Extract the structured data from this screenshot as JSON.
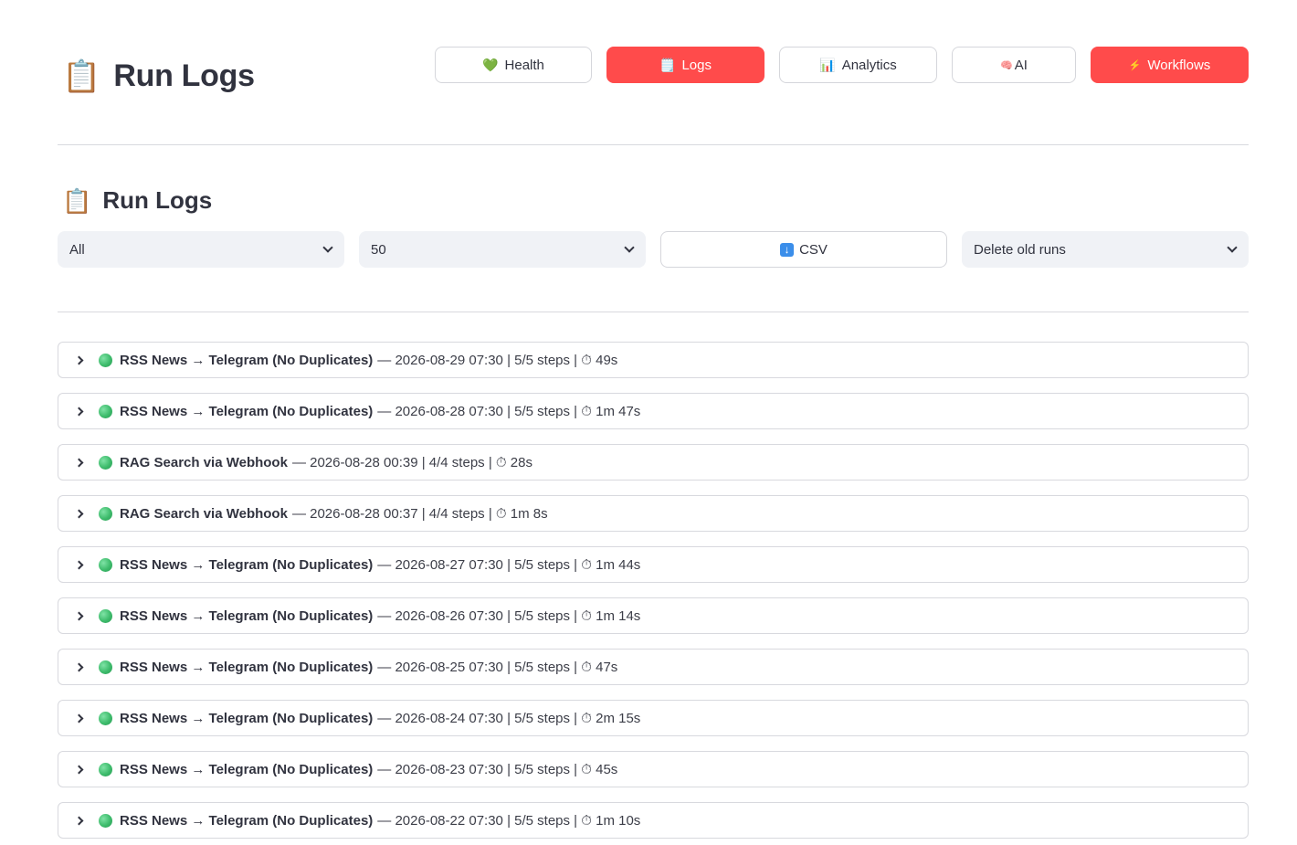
{
  "header": {
    "icon": "clipboard-icon",
    "title": "Run Logs"
  },
  "nav": [
    {
      "label": "Health",
      "icon": "💚",
      "icon_name": "green-heart-icon",
      "active": false
    },
    {
      "label": "Logs",
      "icon": "🗒️",
      "icon_name": "notepad-icon",
      "active": true
    },
    {
      "label": "Analytics",
      "icon": "📊",
      "icon_name": "bar-chart-icon",
      "active": false
    },
    {
      "label": "AI",
      "icon": "🧠",
      "icon_name": "brain-icon",
      "active": false
    },
    {
      "label": "Workflows",
      "icon": "⚡",
      "icon_name": "lightning-icon",
      "active": true
    }
  ],
  "section": {
    "icon": "clipboard-icon",
    "title": "Run Logs"
  },
  "controls": {
    "status_filter": "All",
    "limit": "50",
    "csv_label": "CSV",
    "delete_label": "Delete old runs"
  },
  "colors": {
    "primary": "#ff4b4b",
    "success": "#3dbb6b",
    "select_bg": "#f0f2f6",
    "text": "#31333f"
  },
  "runs": [
    {
      "name": "RSS News → Telegram (No Duplicates)",
      "meta": "— 2026-08-29 07:30 | 5/5 steps | ⏱ 49s",
      "status": "success"
    },
    {
      "name": "RSS News → Telegram (No Duplicates)",
      "meta": "— 2026-08-28 07:30 | 5/5 steps | ⏱ 1m 47s",
      "status": "success"
    },
    {
      "name": "RAG Search via Webhook",
      "meta": "— 2026-08-28 00:39 | 4/4 steps | ⏱ 28s",
      "status": "success"
    },
    {
      "name": "RAG Search via Webhook",
      "meta": "— 2026-08-28 00:37 | 4/4 steps | ⏱ 1m 8s",
      "status": "success"
    },
    {
      "name": "RSS News → Telegram (No Duplicates)",
      "meta": "— 2026-08-27 07:30 | 5/5 steps | ⏱ 1m 44s",
      "status": "success"
    },
    {
      "name": "RSS News → Telegram (No Duplicates)",
      "meta": "— 2026-08-26 07:30 | 5/5 steps | ⏱ 1m 14s",
      "status": "success"
    },
    {
      "name": "RSS News → Telegram (No Duplicates)",
      "meta": "— 2026-08-25 07:30 | 5/5 steps | ⏱ 47s",
      "status": "success"
    },
    {
      "name": "RSS News → Telegram (No Duplicates)",
      "meta": "— 2026-08-24 07:30 | 5/5 steps | ⏱ 2m 15s",
      "status": "success"
    },
    {
      "name": "RSS News → Telegram (No Duplicates)",
      "meta": "— 2026-08-23 07:30 | 5/5 steps | ⏱ 45s",
      "status": "success"
    },
    {
      "name": "RSS News → Telegram (No Duplicates)",
      "meta": "— 2026-08-22 07:30 | 5/5 steps | ⏱ 1m 10s",
      "status": "success"
    }
  ]
}
